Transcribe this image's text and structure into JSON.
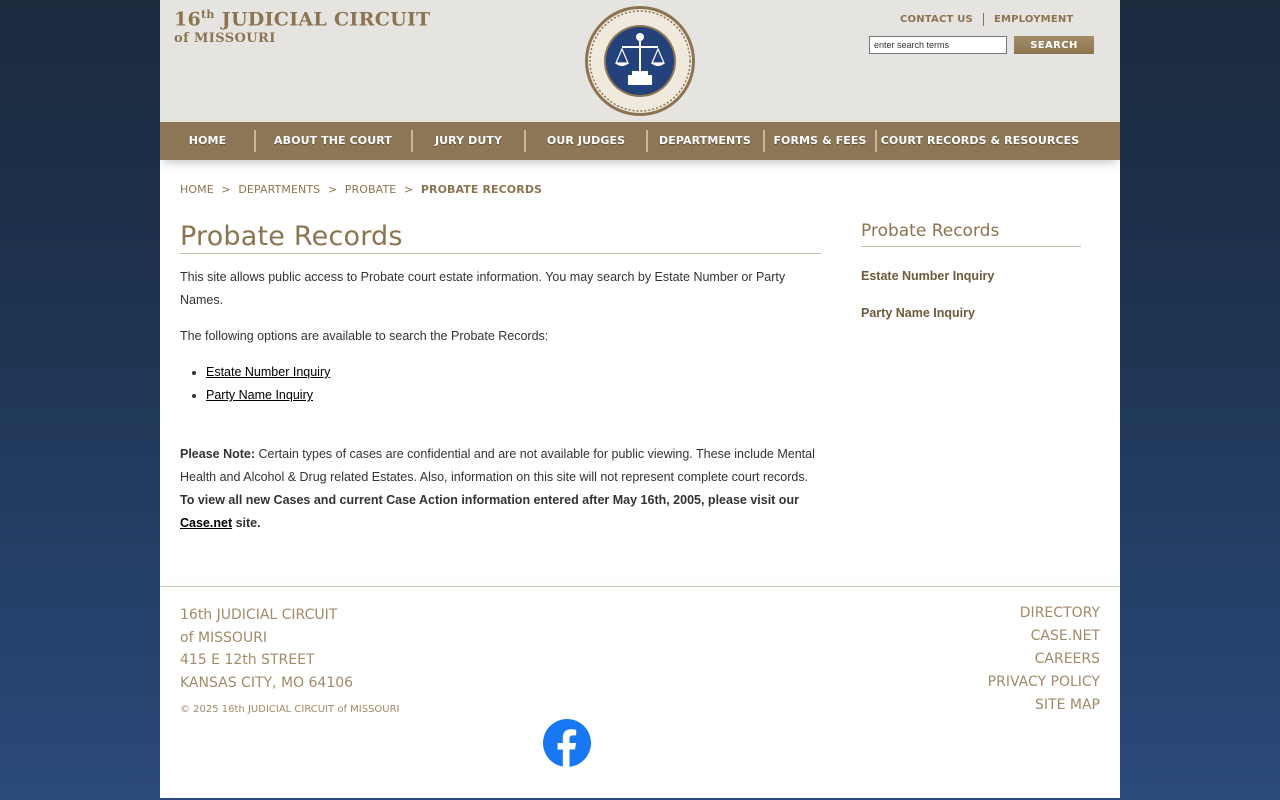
{
  "header": {
    "logo_line1_num": "16",
    "logo_line1_sup": "th",
    "logo_line1_rest": " JUDICIAL CIRCUIT",
    "logo_line2": "of MISSOURI",
    "top_links": [
      "CONTACT US",
      "EMPLOYMENT"
    ],
    "search_placeholder": "enter search terms",
    "search_button": "SEARCH"
  },
  "nav": [
    "HOME",
    "ABOUT THE COURT",
    "JURY DUTY",
    "OUR JUDGES",
    "DEPARTMENTS",
    "FORMS & FEES",
    "COURT RECORDS & RESOURCES"
  ],
  "breadcrumb": [
    "HOME",
    "DEPARTMENTS",
    "PROBATE",
    "PROBATE RECORDS"
  ],
  "breadcrumb_sep": ">",
  "main": {
    "title": "Probate Records",
    "intro": "This site allows public access to Probate court estate information.  You may search by Estate Number or Party Names.",
    "options_text": "The following options are available to search the Probate Records:",
    "links": [
      "Estate Number Inquiry",
      "Party Name Inquiry"
    ],
    "note_label": "Please Note:",
    "note_text": " Certain types of cases are confidential and are not available for public viewing.  These include Mental Health and Alcohol & Drug related Estates.  Also, information on this site will not represent complete court records. ",
    "note_bold": "To view all new Cases and current Case Action information entered after May 16th, 2005, please visit our ",
    "casenet_link": "Case.net",
    "note_end": " site."
  },
  "sidebar": {
    "title": "Probate Records",
    "links": [
      "Estate Number Inquiry",
      "Party Name Inquiry"
    ]
  },
  "footer": {
    "address": [
      "16th JUDICIAL CIRCUIT",
      "of MISSOURI",
      "415 E 12th STREET",
      "KANSAS CITY, MO 64106"
    ],
    "copyright": "© 2025 16th JUDICIAL CIRCUIT of MISSOURI",
    "links": [
      "DIRECTORY",
      "CASE.NET",
      "CAREERS",
      "PRIVACY POLICY",
      "SITE MAP"
    ]
  },
  "colors": {
    "brand": "#8c7450",
    "nav": "#8c7656",
    "facebook": "#1877f2"
  }
}
